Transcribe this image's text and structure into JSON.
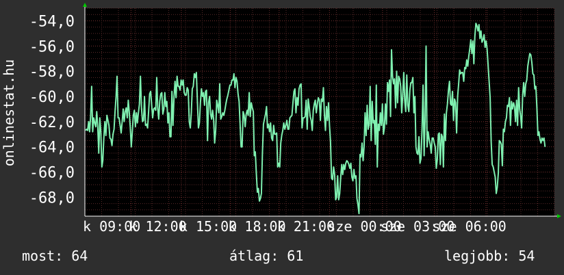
{
  "ylabel": "onlinestat.hu",
  "stats": {
    "now": "most: 64",
    "avg": "átlag: 61",
    "best": "legjobb: 54"
  },
  "colors": {
    "background": "#2e2e2e",
    "plot_bg": "#000000",
    "line": "#7ff0b0",
    "grid": "#5a2a2a",
    "axis_arrow": "#00cc00"
  },
  "chart_data": {
    "type": "line",
    "title": "",
    "ylabel": "onlinestat.hu",
    "ylim": [
      -69.5,
      -53
    ],
    "yticks": [
      -54,
      -56,
      -58,
      -60,
      -62,
      -64,
      -66,
      -68
    ],
    "ytick_labels": [
      "-54,0",
      "-56,0",
      "-58,0",
      "-60,0",
      "-62,0",
      "-64,0",
      "-66,0",
      "-68,0"
    ],
    "xlim": [
      0,
      336
    ],
    "xtick_positions": [
      0,
      33,
      69,
      104,
      139,
      175,
      213,
      250,
      287
    ],
    "xtick_labels": [
      "k 09:00",
      "k 12:00",
      "k 15:00",
      "k 18:00",
      "k 21:00",
      "sze 00:00",
      "sze 03:00",
      "sze 06:00"
    ],
    "grid": true,
    "series": [
      {
        "values": [
          -62.7,
          -62.6,
          -62.7,
          -62.0,
          -62.8,
          -61.6,
          -59.2,
          -62.8,
          -61.7,
          -62.1,
          -62.4,
          -61.2,
          -62.4,
          -64.5,
          -61.7,
          -62.8,
          -65.6,
          -65.1,
          -63.3,
          -62.0,
          -63.1,
          -61.5,
          -61.9,
          -62.3,
          -63.3,
          -63.4,
          -63.9,
          -63.0,
          -62.6,
          -61.2,
          -60.0,
          -58.4,
          -61.7,
          -61.7,
          -62.3,
          -62.9,
          -62.0,
          -61.0,
          -62.0,
          -61.2,
          -60.9,
          -61.7,
          -60.3,
          -61.3,
          -62.4,
          -64.0,
          -62.8,
          -61.5,
          -61.1,
          -62.4,
          -61.3,
          -62.1,
          -61.3,
          -60.6,
          -58.4,
          -60.9,
          -62.0,
          -61.9,
          -60.0,
          -62.3,
          -62.2,
          -62.5,
          -61.2,
          -59.8,
          -59.6,
          -60.6,
          -61.7,
          -61.0,
          -60.9,
          -61.1,
          -58.5,
          -60.9,
          -61.8,
          -60.4,
          -59.8,
          -59.7,
          -61.4,
          -61.0,
          -59.7,
          -60.8,
          -60.4,
          -62.1,
          -61.3,
          -63.2,
          -63.2,
          -59.6,
          -62.3,
          -60.1,
          -58.8,
          -60.1,
          -58.4,
          -59.2,
          -59.2,
          -59.5,
          -58.7,
          -59.1,
          -58.7,
          -59.7,
          -59.9,
          -59.9,
          -59.3,
          -59.5,
          -62.0,
          -62.5,
          -61.3,
          -59.4,
          -59.2,
          -58.2,
          -58.5,
          -58.1,
          -60.4,
          -62.5,
          -62.1,
          -60.5,
          -59.4,
          -60.0,
          -59.7,
          -60.7,
          -59.6,
          -59.5,
          -63.5,
          -60.5,
          -60.0,
          -61.4,
          -61.8,
          -61.1,
          -61.8,
          -63.7,
          -62.7,
          -60.3,
          -60.7,
          -61.3,
          -59.0,
          -61.8,
          -61.6,
          -61.3,
          -61.5,
          -61.1,
          -60.6,
          -60.2,
          -59.9,
          -59.5,
          -59.1,
          -59.1,
          -58.7,
          -58.7,
          -58.2,
          -59.3,
          -58.5,
          -58.8,
          -59.8,
          -60.4,
          -62.1,
          -64.0,
          -64.0,
          -61.2,
          -61.5,
          -62.4,
          -61.4,
          -61.1,
          -61.5,
          -59.7,
          -61.6,
          -60.5,
          -60.9,
          -61.2,
          -64.7,
          -64.4,
          -66.1,
          -67.6,
          -67.3,
          -68.3,
          -68.1,
          -67.7,
          -64.5,
          -62.2,
          -61.8,
          -61.4,
          -60.8,
          -62.5,
          -62.2,
          -62.8,
          -62.1,
          -63.3,
          -63.5,
          -62.3,
          -63.0,
          -63.0,
          -62.9,
          -65.6,
          -65.3,
          -65.6,
          -63.7,
          -63.1,
          -62.7,
          -62.1,
          -62.6,
          -62.3,
          -61.9,
          -62.6,
          -62.6,
          -61.7,
          -61.6,
          -61.5,
          -60.5,
          -59.6,
          -59.4,
          -61.3,
          -60.1,
          -60.7,
          -59.4,
          -59.1,
          -59.0,
          -62.5,
          -61.7,
          -61.7,
          -61.6,
          -60.3,
          -62.6,
          -60.2,
          -60.8,
          -61.6,
          -61.9,
          -62.7,
          -61.1,
          -60.6,
          -60.3,
          -61.3,
          -60.6,
          -60.1,
          -60.3,
          -61.9,
          -60.2,
          -60.4,
          -59.3,
          -61.5,
          -62.7,
          -60.8,
          -61.9,
          -60.5,
          -62.3,
          -63.6,
          -66.5,
          -66.6,
          -65.6,
          -66.2,
          -68.2,
          -68.0,
          -66.3,
          -68.2,
          -67.7,
          -66.4,
          -65.4,
          -66.2,
          -65.4,
          -65.8,
          -65.3,
          -65.1,
          -65.2,
          -65.4,
          -65.7,
          -65.3,
          -66.4,
          -66.7,
          -65.8,
          -66.5,
          -66.3,
          -68.1,
          -68.6,
          -69.3,
          -64.6,
          -64.8,
          -63.7,
          -65.1,
          -64.0,
          -61.3,
          -63.1,
          -60.7,
          -62.6,
          -62.2,
          -59.2,
          -63.5,
          -60.4,
          -62.1,
          -61.9,
          -63.8,
          -59.1,
          -65.6,
          -62.2,
          -62.7,
          -61.3,
          -62.3,
          -60.6,
          -63.0,
          -62.5,
          -60.6,
          -62.2,
          -58.9,
          -59.6,
          -58.7,
          -61.6,
          -56.3,
          -58.4,
          -59.0,
          -58.6,
          -60.9,
          -58.0,
          -60.5,
          -58.4,
          -58.6,
          -59.2,
          -61.3,
          -59.9,
          -58.1,
          -60.3,
          -61.2,
          -58.3,
          -60.7,
          -61.2,
          -59.5,
          -58.9,
          -58.9,
          -58.5,
          -61.3,
          -60.0,
          -64.0,
          -64.5,
          -64.6,
          -63.2,
          -65.3,
          -64.9,
          -62.6,
          -59.1,
          -64.7,
          -61.9,
          -56.0,
          -64.0,
          -62.8,
          -63.4,
          -63.8,
          -64.5,
          -63.3,
          -63.3,
          -63.7,
          -64.0,
          -65.7,
          -65.0,
          -63.0,
          -62.9,
          -65.4,
          -63.0,
          -63.2,
          -65.6,
          -61.4,
          -63.5,
          -61.3,
          -60.6,
          -59.5,
          -58.8,
          -60.6,
          -60.7,
          -59.6,
          -61.9,
          -60.2,
          -60.5,
          -62.9,
          -60.0,
          -59.0,
          -57.9,
          -58.2,
          -58.1,
          -58.1,
          -58.8,
          -57.7,
          -57.8,
          -57.1,
          -57.6,
          -56.8,
          -56.2,
          -55.5,
          -56.6,
          -55.6,
          -57.4,
          -55.2,
          -54.2,
          -54.4,
          -54.8,
          -54.3,
          -55.4,
          -54.8,
          -55.7,
          -55.5,
          -55.1,
          -56.1,
          -55.6,
          -56.2,
          -57.5,
          -58.8,
          -60.1,
          -63.6,
          -65.4,
          -65.6,
          -66.0,
          -66.4,
          -67.7,
          -67.2,
          -66.1,
          -63.5,
          -63.6,
          -63.8,
          -65.5,
          -62.6,
          -62.8,
          -62.0,
          -61.7,
          -60.7,
          -60.8,
          -60.1,
          -62.3,
          -60.4,
          -61.0,
          -60.5,
          -60.8,
          -62.0,
          -60.3,
          -62.3,
          -59.3,
          -61.0,
          -61.6,
          -62.5,
          -59.9,
          -58.9,
          -60.0,
          -59.0,
          -58.7,
          -57.6,
          -57.1,
          -56.6,
          -56.7,
          -57.3,
          -58.2,
          -58.3,
          -59.4,
          -59.2,
          -60.9,
          -63.1,
          -62.8,
          -63.4,
          -63.7,
          -63.3,
          -63.5,
          -63.3,
          -64.0
        ]
      }
    ]
  }
}
